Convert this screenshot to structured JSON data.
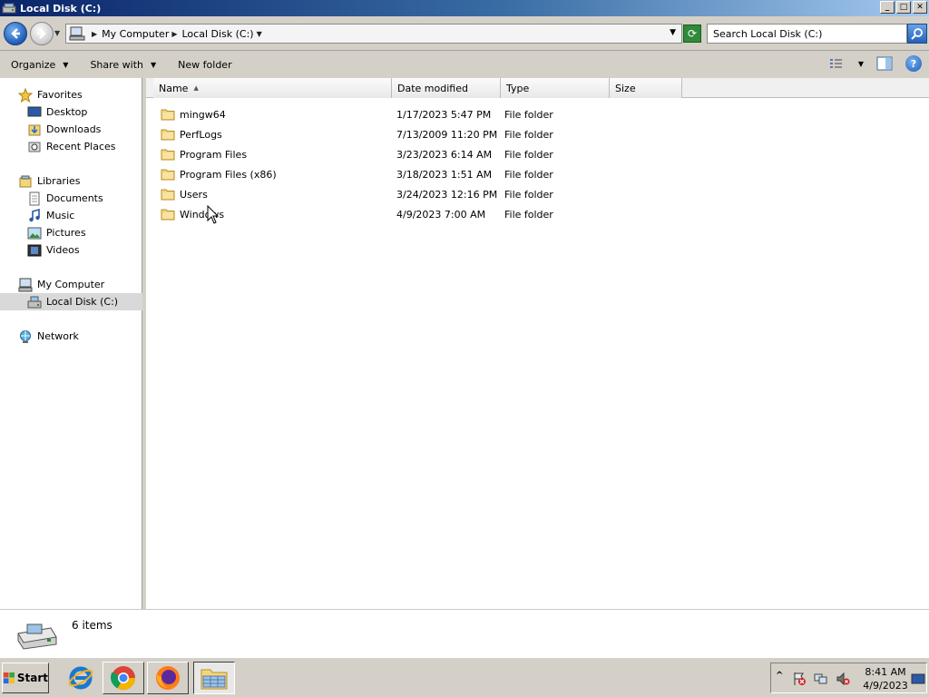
{
  "window": {
    "title": "Local Disk (C:)"
  },
  "window_buttons": {
    "minimize": "_",
    "maximize": "□",
    "close": "✕"
  },
  "address": {
    "crumbs": [
      "My Computer",
      "Local Disk (C:)"
    ],
    "search_placeholder": "Search Local Disk (C:)"
  },
  "toolbar": {
    "organize": "Organize",
    "share_with": "Share with",
    "new_folder": "New folder"
  },
  "nav": {
    "favorites": "Favorites",
    "desktop": "Desktop",
    "downloads": "Downloads",
    "recent_places": "Recent Places",
    "libraries": "Libraries",
    "documents": "Documents",
    "music": "Music",
    "pictures": "Pictures",
    "videos": "Videos",
    "my_computer": "My Computer",
    "local_disk": "Local Disk (C:)",
    "network": "Network"
  },
  "columns": {
    "name": "Name",
    "date_modified": "Date modified",
    "type": "Type",
    "size": "Size"
  },
  "files": [
    {
      "name": "mingw64",
      "date": "1/17/2023 5:47 PM",
      "type": "File folder",
      "size": ""
    },
    {
      "name": "PerfLogs",
      "date": "7/13/2009 11:20 PM",
      "type": "File folder",
      "size": ""
    },
    {
      "name": "Program Files",
      "date": "3/23/2023 6:14 AM",
      "type": "File folder",
      "size": ""
    },
    {
      "name": "Program Files (x86)",
      "date": "3/18/2023 1:51 AM",
      "type": "File folder",
      "size": ""
    },
    {
      "name": "Users",
      "date": "3/24/2023 12:16 PM",
      "type": "File folder",
      "size": ""
    },
    {
      "name": "Windows",
      "date": "4/9/2023 7:00 AM",
      "type": "File folder",
      "size": ""
    }
  ],
  "details": {
    "item_count": "6 items"
  },
  "taskbar": {
    "start": "Start",
    "apps": [
      "internet-explorer-icon",
      "chrome-icon",
      "firefox-icon",
      "file-explorer-icon"
    ],
    "clock_time": "8:41 AM",
    "clock_date": "4/9/2023"
  },
  "colors": {
    "title_gradient_start": "#0a246a",
    "title_gradient_end": "#a6caf0",
    "chrome_gray": "#d4d0c8",
    "selection_gray": "#d9d9d9"
  }
}
